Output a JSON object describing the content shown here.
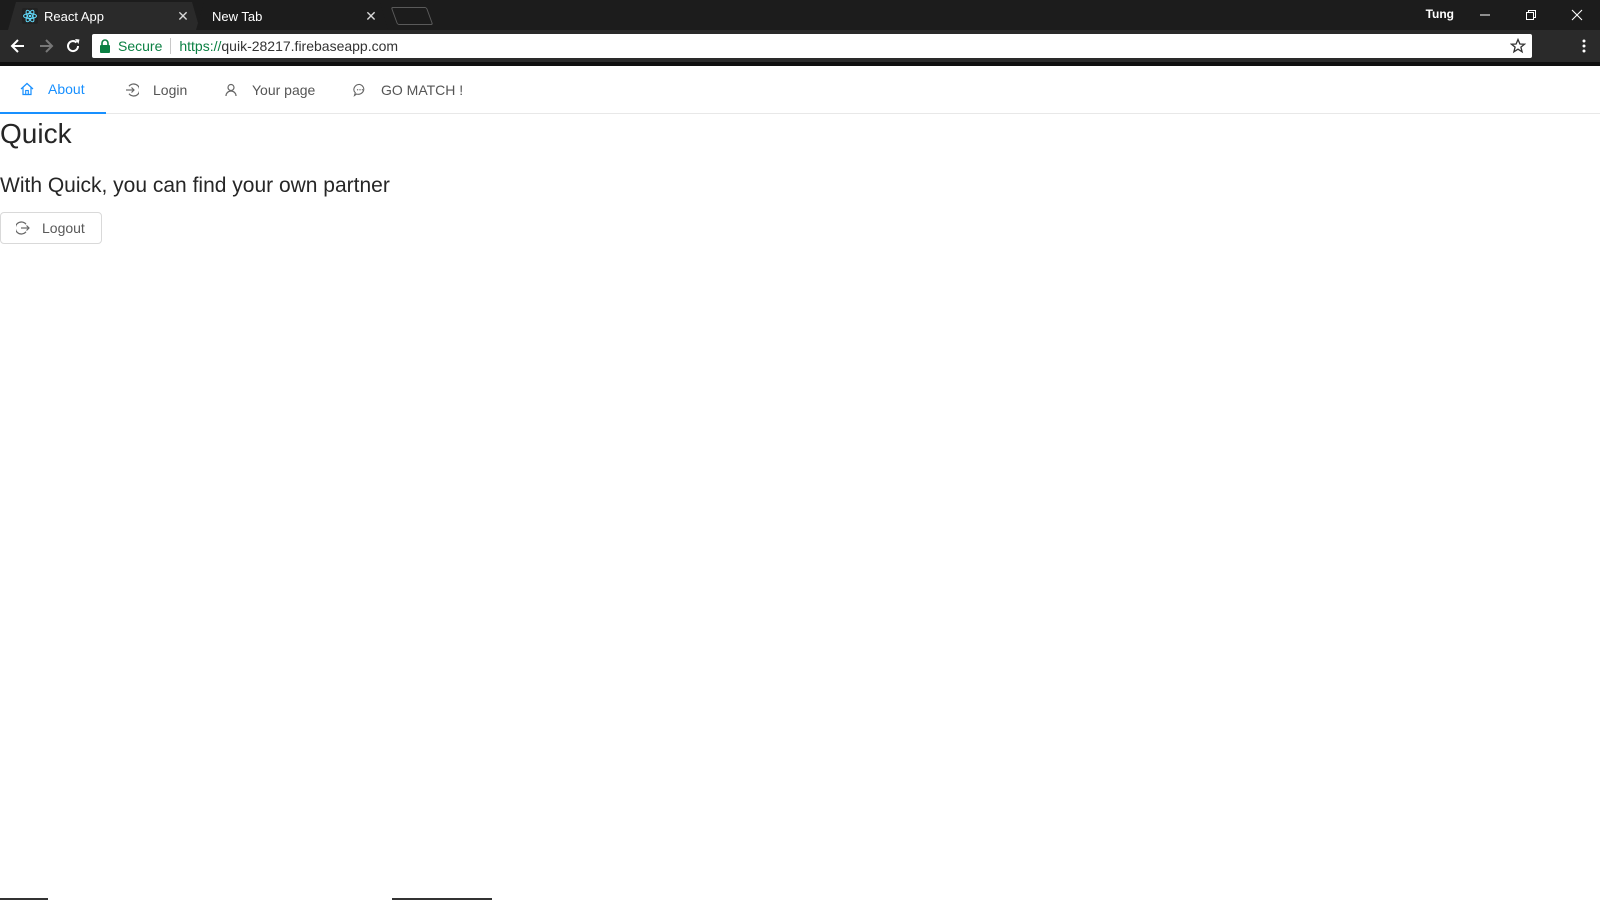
{
  "browser": {
    "tabs": [
      {
        "title": "React App",
        "active": true
      },
      {
        "title": "New Tab",
        "active": false
      }
    ],
    "profile_name": "Tung",
    "omnibox": {
      "security_label": "Secure",
      "url_scheme": "https://",
      "url_host": "quik-28217.firebaseapp.com"
    }
  },
  "navbar": {
    "items": [
      {
        "label": "About",
        "icon": "home-icon",
        "active": true
      },
      {
        "label": "Login",
        "icon": "login-icon",
        "active": false
      },
      {
        "label": "Your page",
        "icon": "user-icon",
        "active": false
      },
      {
        "label": "GO MATCH !",
        "icon": "message-icon",
        "active": false
      }
    ]
  },
  "main": {
    "title": "Quick",
    "subtitle": "With Quick, you can find your own partner",
    "logout_label": "Logout"
  },
  "colors": {
    "accent": "#1890ff",
    "secure_green": "#0b8043",
    "chrome_dark": "#1c1c1c"
  }
}
